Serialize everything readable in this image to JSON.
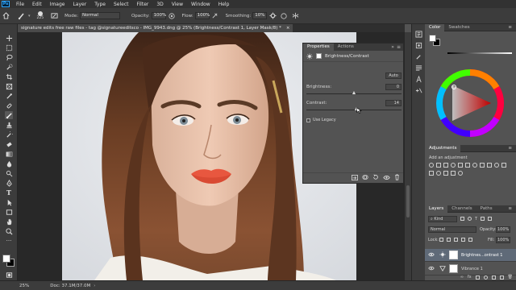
{
  "menu": {
    "logo": "Ps",
    "items": [
      "File",
      "Edit",
      "Image",
      "Layer",
      "Type",
      "Select",
      "Filter",
      "3D",
      "View",
      "Window",
      "Help"
    ]
  },
  "options": {
    "brush_size": "225",
    "mode_label": "Mode:",
    "mode_value": "Normal",
    "opacity_label": "Opacity:",
    "opacity_value": "100%",
    "flow_label": "Flow:",
    "flow_value": "100%",
    "smoothing_label": "Smoothing:",
    "smoothing_value": "10%"
  },
  "document": {
    "tab_title": "signature edits free raw files - tag @signatureeditsco - IMG_9943.dng @ 25% (Brightness/Contrast 1, Layer Mask/8) *",
    "close_glyph": "×"
  },
  "properties": {
    "tabs": [
      "Properties",
      "Actions"
    ],
    "title": "Brightness/Contrast",
    "auto_label": "Auto",
    "brightness_label": "Brightness:",
    "brightness_value": "0",
    "contrast_label": "Contrast:",
    "contrast_value": "14",
    "legacy_label": "Use Legacy",
    "brightness_fraction": 0.5,
    "contrast_fraction": 0.53
  },
  "color_panel": {
    "tabs": [
      "Color",
      "Swatches"
    ],
    "foreground": "#ffffff",
    "background": "#000000"
  },
  "adjustments": {
    "title": "Adjustments",
    "subtitle": "Add an adjustment"
  },
  "layers": {
    "tabs": [
      "Layers",
      "Channels",
      "Paths"
    ],
    "filter_label": "Kind",
    "blend_mode": "Normal",
    "opacity_label": "Opacity:",
    "opacity_value": "100%",
    "lock_label": "Lock:",
    "fill_label": "Fill:",
    "fill_value": "100%",
    "items": [
      {
        "name": "Brightnes...ontrast 1"
      },
      {
        "name": "Vibrance 1"
      }
    ]
  },
  "status": {
    "zoom": "25%",
    "doc_info": "Doc: 37.1M/37.0M"
  },
  "colors": {
    "accent": "#31a8ff",
    "panel": "#535353",
    "dark": "#3c3c3c",
    "lips": "#e8573f",
    "hair": "#6b3e24"
  }
}
